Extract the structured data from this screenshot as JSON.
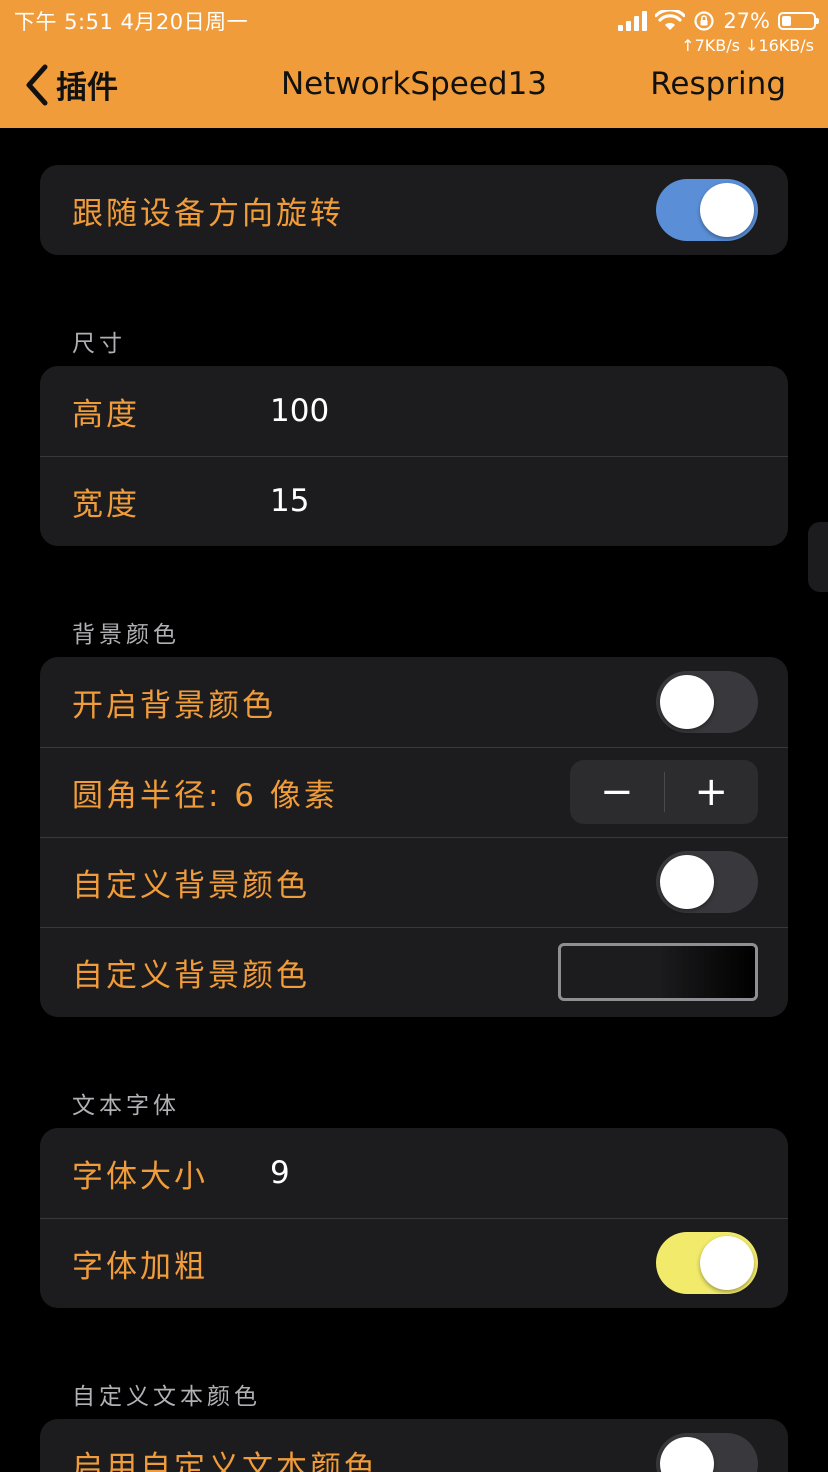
{
  "status_bar": {
    "time_date": "下午 5:51   4月20日周一",
    "battery_percent": "27%",
    "battery_level": 0.27,
    "net_speed": "↑7KB/s ↓16KB/s"
  },
  "nav": {
    "back_label": "插件",
    "title": "NetworkSpeed13",
    "action_label": "Respring"
  },
  "groups": {
    "rotate": {
      "label": "跟随设备方向旋转",
      "on": true,
      "switch_color": "#5a8fd8"
    },
    "size": {
      "header": "尺寸",
      "rows": [
        {
          "label": "高度",
          "value": "100"
        },
        {
          "label": "宽度",
          "value": "15"
        }
      ]
    },
    "background": {
      "header": "背景颜色",
      "enable_label": "开启背景颜色",
      "enable_on": false,
      "radius_label": "圆角半径: 6 像素",
      "stepper_minus": "−",
      "stepper_plus": "+",
      "custom_label": "自定义背景颜色",
      "custom_on": false,
      "custom_color_label": "自定义背景颜色"
    },
    "font": {
      "header": "文本字体",
      "size_label": "字体大小",
      "size_value": "9",
      "bold_label": "字体加粗",
      "bold_on": true,
      "bold_switch_color": "#f1ea6a"
    },
    "text_color": {
      "header": "自定义文本颜色",
      "enable_label": "启用自定义文本颜色",
      "enable_on": false
    }
  },
  "colors": {
    "accent": "#f09c3a",
    "background": "#000000",
    "group_bg": "#1c1c1e"
  }
}
